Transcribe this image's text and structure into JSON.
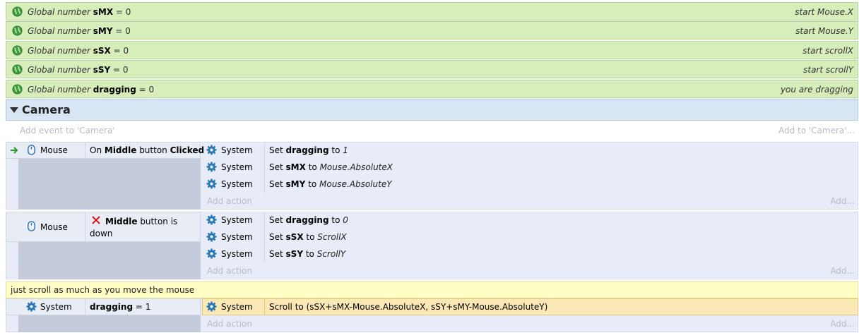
{
  "globals": [
    {
      "prefix": "Global number ",
      "name": "sMX",
      "suffix": " = 0",
      "comment": "start Mouse.X"
    },
    {
      "prefix": "Global number ",
      "name": "sMY",
      "suffix": " = 0",
      "comment": "start Mouse.Y"
    },
    {
      "prefix": "Global number ",
      "name": "sSX",
      "suffix": " = 0",
      "comment": "start scrollX"
    },
    {
      "prefix": "Global number ",
      "name": "sSY",
      "suffix": " = 0",
      "comment": "start scrollY"
    },
    {
      "prefix": "Global number ",
      "name": "dragging",
      "suffix": " = 0",
      "comment": "you are dragging"
    }
  ],
  "group": {
    "title": "Camera",
    "add_event": "Add event to 'Camera'",
    "add_to": "Add to 'Camera'..."
  },
  "event1": {
    "object": "Mouse",
    "cond_pre": "On ",
    "cond_b1": "Middle",
    "cond_mid": " button ",
    "cond_b2": "Clicked",
    "actions": [
      {
        "object": "System",
        "pre": "Set ",
        "bold": "dragging",
        "mid": " to ",
        "val": "1"
      },
      {
        "object": "System",
        "pre": "Set ",
        "bold": "sMX",
        "mid": " to ",
        "val": "Mouse.AbsoluteX"
      },
      {
        "object": "System",
        "pre": "Set ",
        "bold": "sMY",
        "mid": " to ",
        "val": "Mouse.AbsoluteY"
      }
    ],
    "add_action": "Add action",
    "add_more": "Add..."
  },
  "event2": {
    "object": "Mouse",
    "cond_bold": "Middle",
    "cond_rest1": " button is",
    "cond_rest2": "down",
    "actions": [
      {
        "object": "System",
        "pre": "Set ",
        "bold": "dragging",
        "mid": " to ",
        "val": "0"
      },
      {
        "object": "System",
        "pre": "Set ",
        "bold": "sSX",
        "mid": " to ",
        "val": "ScrollX"
      },
      {
        "object": "System",
        "pre": "Set ",
        "bold": "sSY",
        "mid": " to ",
        "val": "ScrollY"
      }
    ],
    "add_action": "Add action",
    "add_more": "Add..."
  },
  "comment": "just scroll as much as you move the mouse",
  "event3": {
    "object": "System",
    "cond_bold": "dragging",
    "cond_rest": " = 1",
    "action_object": "System",
    "action_text": "Scroll to (sSX+sMX-Mouse.AbsoluteX, sSY+sMY-Mouse.AbsoluteY)",
    "add_action": "Add action",
    "add_more": "Add..."
  },
  "icons": {
    "globe": "globe-icon",
    "mouse": "mouse-icon",
    "gear": "gear-icon",
    "arrow": "trigger-arrow-icon",
    "invert": "invert-x-icon"
  },
  "colors": {
    "global_row": "#d7eebb",
    "group_header": "#d7e5f4",
    "event_bg": "#e7ecf8",
    "comment_bg": "#ffffc5",
    "selected_action": "#fbe9b5",
    "trigger_arrow": "#2a9a2a",
    "invert_x": "#d62020"
  }
}
